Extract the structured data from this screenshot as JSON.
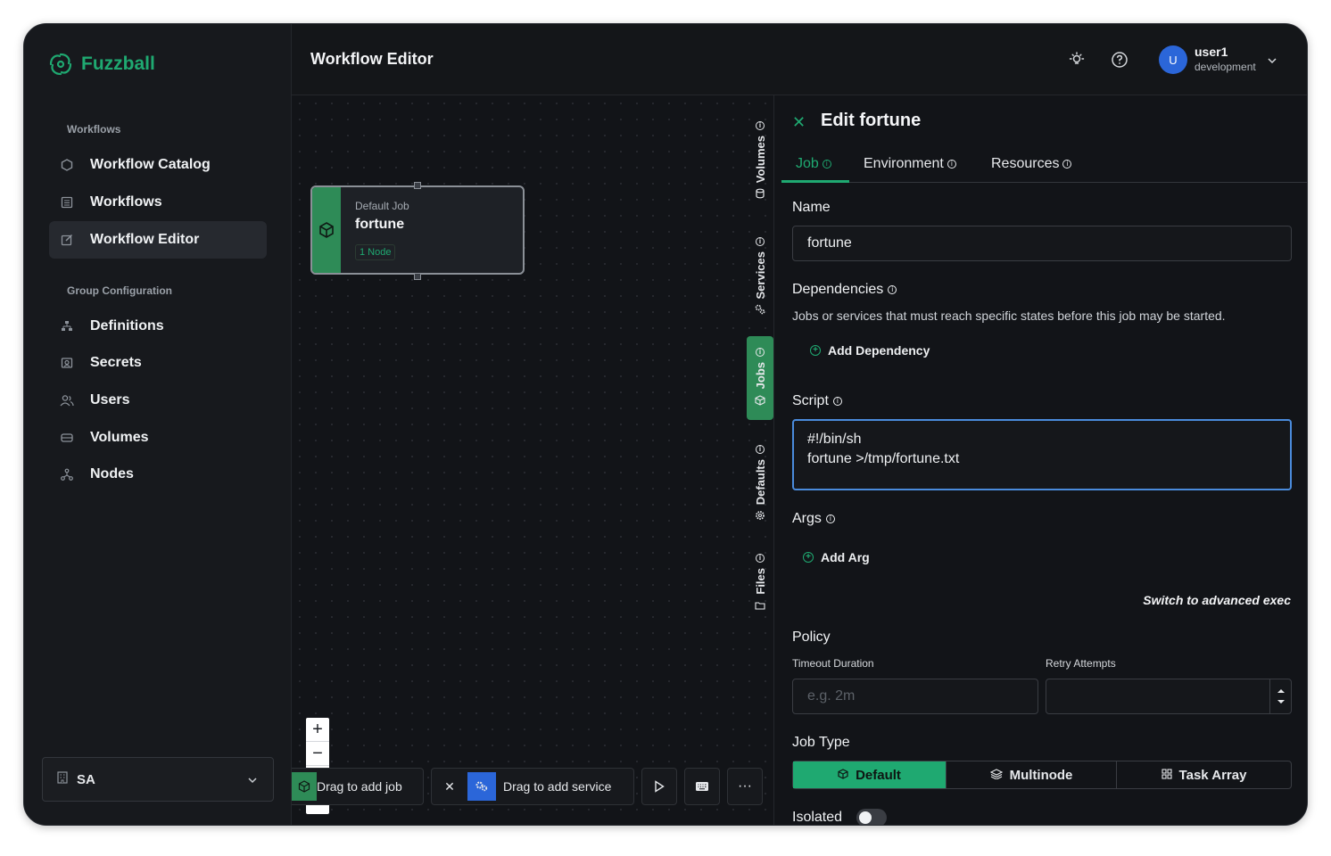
{
  "app": {
    "name": "Fuzzball",
    "brand_color": "#1fa971"
  },
  "sidebar": {
    "sections": [
      {
        "title": "Workflows",
        "items": [
          {
            "label": "Workflow Catalog",
            "icon": "hexagon-icon"
          },
          {
            "label": "Workflows",
            "icon": "list-icon"
          },
          {
            "label": "Workflow Editor",
            "icon": "edit-icon",
            "active": true
          }
        ]
      },
      {
        "title": "Group Configuration",
        "items": [
          {
            "label": "Definitions",
            "icon": "sitemap-icon"
          },
          {
            "label": "Secrets",
            "icon": "secret-icon"
          },
          {
            "label": "Users",
            "icon": "users-icon"
          },
          {
            "label": "Volumes",
            "icon": "drive-icon"
          },
          {
            "label": "Nodes",
            "icon": "nodes-icon"
          }
        ]
      }
    ],
    "group_selector": {
      "value": "SA"
    }
  },
  "header": {
    "title": "Workflow Editor",
    "user": {
      "initial": "U",
      "name": "user1",
      "org": "development"
    }
  },
  "canvas": {
    "node": {
      "subtitle": "Default Job",
      "name": "fortune",
      "badge": "1 Node"
    },
    "side_tabs": [
      "Volumes",
      "Services",
      "Jobs",
      "Defaults",
      "Files"
    ],
    "active_side_tab": "Jobs",
    "bottom": {
      "add_job": "Drag to add job",
      "add_service": "Drag to add service"
    }
  },
  "panel": {
    "title": "Edit fortune",
    "tabs": [
      "Job",
      "Environment",
      "Resources"
    ],
    "active_tab": "Job",
    "name_label": "Name",
    "name_value": "fortune",
    "deps_label": "Dependencies",
    "deps_hint": "Jobs or services that must reach specific states before this job may be started.",
    "add_dependency": "Add Dependency",
    "script_label": "Script",
    "script_line1": "#!/bin/sh",
    "script_line2": "fortune >/tmp/fortune.txt",
    "args_label": "Args",
    "add_arg": "Add Arg",
    "advanced_link": "Switch to advanced exec",
    "policy_label": "Policy",
    "timeout_label": "Timeout Duration",
    "timeout_placeholder": "e.g. 2m",
    "retry_label": "Retry Attempts",
    "job_type_label": "Job Type",
    "job_types": [
      "Default",
      "Multinode",
      "Task Array"
    ],
    "active_job_type": "Default",
    "isolated_label": "Isolated",
    "isolated": false
  }
}
